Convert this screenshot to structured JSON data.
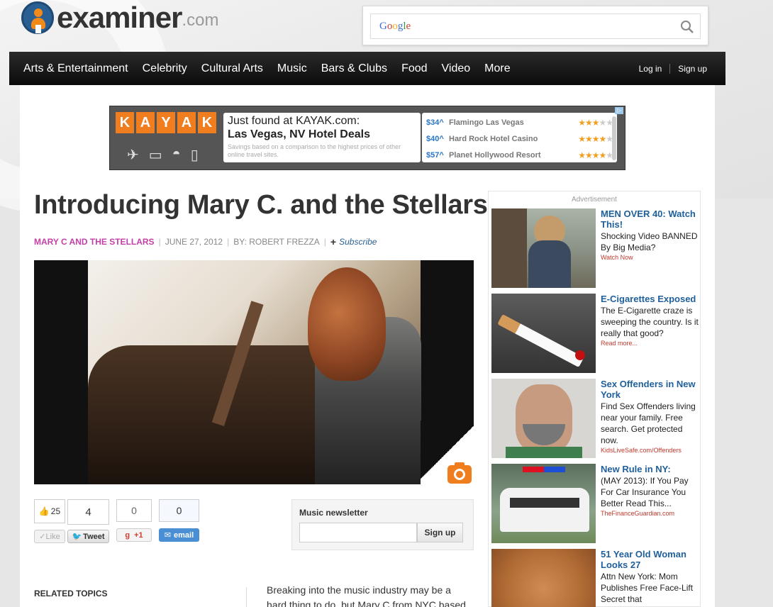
{
  "logo": {
    "word": "examiner",
    "tld": ".com"
  },
  "search": {
    "brand": "Google",
    "placeholder": ""
  },
  "nav": {
    "items": [
      "Arts & Entertainment",
      "Celebrity",
      "Cultural Arts",
      "Music",
      "Bars & Clubs",
      "Food",
      "Video",
      "More"
    ],
    "login": "Log in",
    "signup": "Sign up"
  },
  "kayak_ad": {
    "brand_letters": [
      "K",
      "A",
      "Y",
      "A",
      "K"
    ],
    "line1": "Just found at KAYAK.com:",
    "line2": "Las Vegas, NV Hotel Deals",
    "line3": "Savings based on a comparison to the highest prices of other online travel sites.",
    "deals": [
      {
        "price": "$34^",
        "name": "Flamingo Las Vegas",
        "stars": 3
      },
      {
        "price": "$40^",
        "name": "Hard Rock Hotel  Casino",
        "stars": 4
      },
      {
        "price": "$57^",
        "name": "Planet Hollywood Resort",
        "stars": 4
      }
    ]
  },
  "article": {
    "title": "Introducing Mary C. and the Stellars",
    "category": "MARY C AND THE STELLARS",
    "date": "JUNE 27, 2012",
    "author": "BY: ROBERT FREZZA",
    "subscribe": "Subscribe",
    "body_line1": "Breaking into the music industry may be a",
    "body_line2": "hard thing to do, but Mary C from NYC based"
  },
  "social": {
    "fb_count": "25",
    "fb_label": "Like",
    "tweet_count": "4",
    "tweet_label": "Tweet",
    "gplus_count": "0",
    "gplus_label": "+1",
    "email_count": "0",
    "email_label": "email"
  },
  "newsletter": {
    "label": "Music newsletter",
    "button": "Sign up",
    "placeholder": ""
  },
  "related_topics": "RELATED TOPICS",
  "sidebar": {
    "ad_label": "Advertisement",
    "items": [
      {
        "headline": "MEN OVER 40: Watch This!",
        "desc": "Shocking Video BANNED By Big Media?",
        "link": "Watch Now"
      },
      {
        "headline": "E-Cigarettes Exposed",
        "desc": "The E-Cigarette craze is sweeping the country. Is it really that good?",
        "link": "Read more..."
      },
      {
        "headline": "Sex Offenders in New York",
        "desc": "Find Sex Offenders living near your family. Free search. Get protected now.",
        "link": "KidsLiveSafe.com/Offenders"
      },
      {
        "headline": "New Rule in NY:",
        "desc": "(MAY 2013): If You Pay For Car Insurance You Better Read This...",
        "link": "TheFinanceGuardian.com"
      },
      {
        "headline": "51 Year Old Woman Looks 27",
        "desc": "Attn New York: Mom Publishes Free Face-Lift Secret that",
        "link": ""
      }
    ]
  },
  "colors": {
    "nav_bg": "#111111",
    "category": "#c33fa7",
    "link_blue": "#1f5f9a",
    "kayak_orange": "#f07d1e",
    "ad_link_red": "#c0392b"
  }
}
